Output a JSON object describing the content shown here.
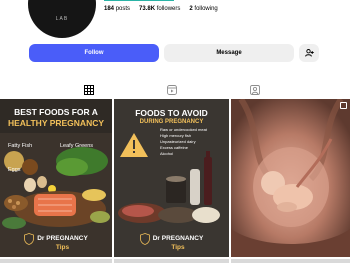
{
  "profile": {
    "avatar_text": "LAB",
    "posts_count": "184",
    "posts_label": "posts",
    "followers_count": "73.8K",
    "followers_label": "followers",
    "following_count": "2",
    "following_label": "following"
  },
  "actions": {
    "follow_label": "Follow",
    "message_label": "Message"
  },
  "tabs": [
    {
      "name": "posts",
      "icon": "grid-icon",
      "active": true
    },
    {
      "name": "reels",
      "icon": "reels-icon",
      "active": false
    },
    {
      "name": "tagged",
      "icon": "tagged-icon",
      "active": false
    }
  ],
  "posts": [
    {
      "title_line1": "BEST FOODS FOR A",
      "title_line2": "HEALTHY PREGNANCY",
      "labels": [
        "Fatty Fish",
        "Leafy Greens",
        "Eggs"
      ],
      "brand_line1": "Dr PREGNANCY",
      "brand_line2": "Tips"
    },
    {
      "title_line1": "FOODS TO AVOID",
      "title_line2": "DURING PREGNANCY",
      "list": [
        "Raw or undercooked meat",
        "High mercury fish",
        "Unpasteurized dairy",
        "Excess caffeine",
        "Alcohol"
      ],
      "brand_line1": "Dr PREGNANCY",
      "brand_line2": "Tips"
    },
    {
      "image": "fetus-in-womb"
    }
  ],
  "colors": {
    "follow_button": "#4a5df9",
    "secondary_button": "#efefef",
    "accent_gold": "#f2c05a"
  }
}
